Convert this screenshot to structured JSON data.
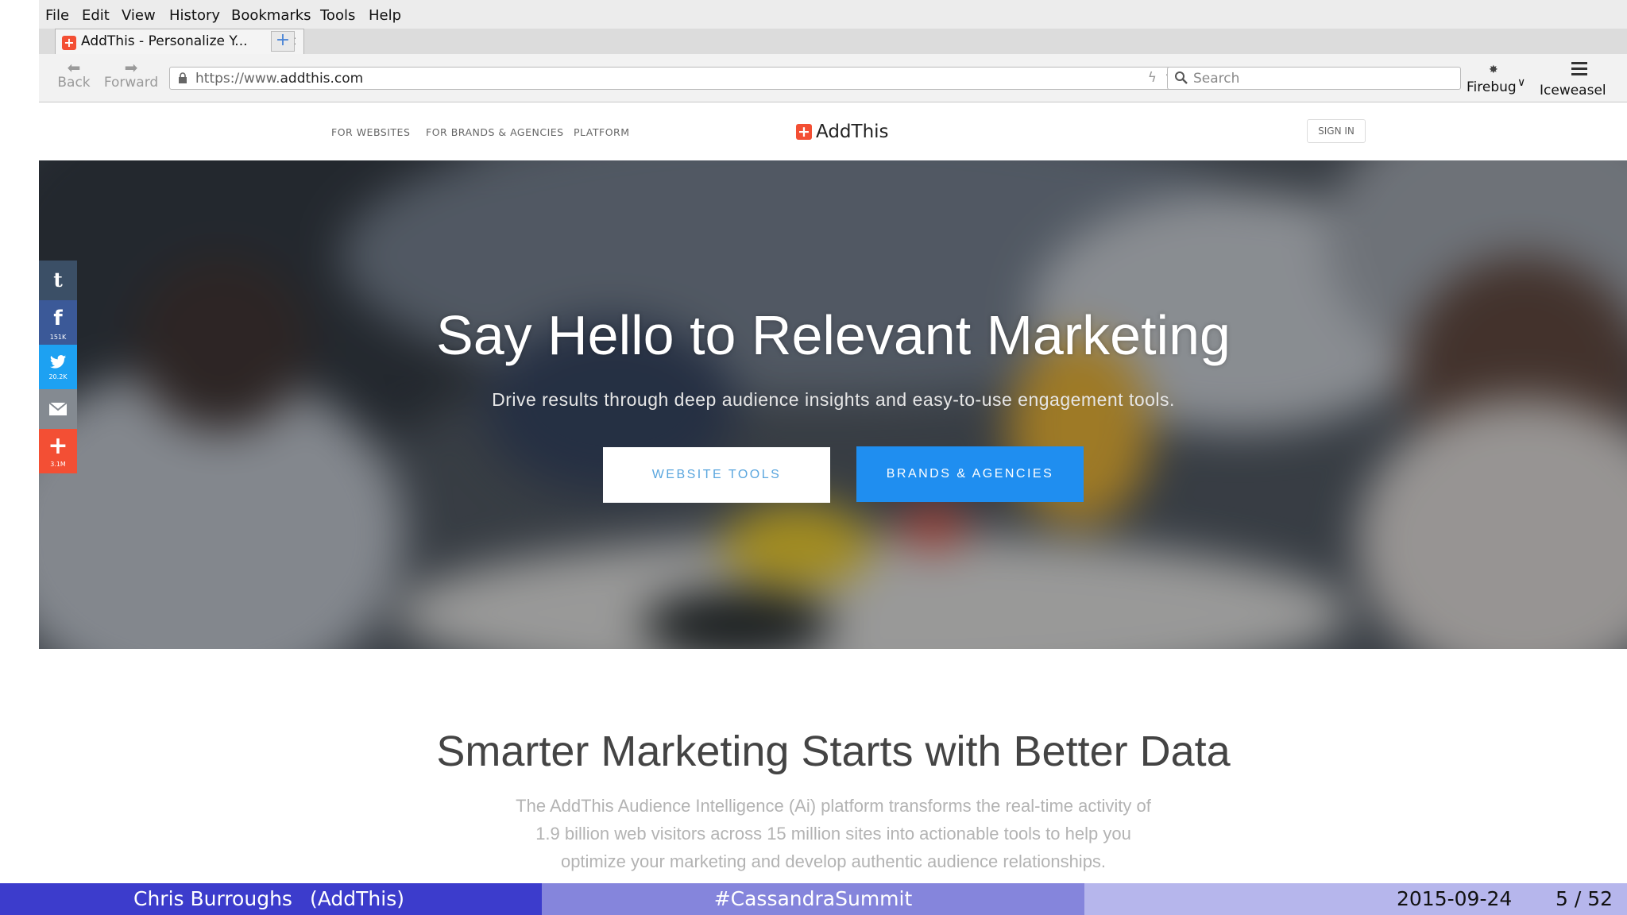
{
  "menubar": {
    "items": [
      "File",
      "Edit",
      "View",
      "History",
      "Bookmarks",
      "Tools",
      "Help"
    ]
  },
  "tab": {
    "title": "AddThis - Personalize Y...",
    "close": "×",
    "new_tab": "+"
  },
  "navbar": {
    "back_label": "Back",
    "forward_label": "Forward",
    "url_prefix": "https://www.",
    "url_domain": "addthis.com",
    "search_placeholder": "Search",
    "firebug_label": "Firebug",
    "menu_label": "Iceweasel"
  },
  "site": {
    "nav": [
      "FOR WEBSITES",
      "FOR BRANDS & AGENCIES",
      "PLATFORM"
    ],
    "logo_text": "AddThis",
    "signin_label": "SIGN IN"
  },
  "hero": {
    "title": "Say Hello to Relevant Marketing",
    "subtitle": "Drive results through deep audience insights and easy-to-use engagement tools.",
    "btn_website": "WEBSITE TOOLS",
    "btn_brands": "BRANDS & AGENCIES"
  },
  "share": {
    "facebook_count": "151K",
    "twitter_count": "20.2K",
    "more_count": "3.1M"
  },
  "lower": {
    "title": "Smarter Marketing Starts with Better Data",
    "body_line1": "The AddThis Audience Intelligence (Ai) platform transforms the real-time activity of",
    "body_line2": "1.9 billion web visitors across 15 million sites into actionable tools to help you",
    "body_line3": "optimize your marketing and develop authentic audience relationships."
  },
  "footer": {
    "author": "Chris Burroughs",
    "affiliation": "(AddThis)",
    "event": "#CassandraSummit",
    "date": "2015-09-24",
    "page": "5 / 52"
  },
  "colors": {
    "brand_red": "#f34f34",
    "brand_blue": "#1f8ef0",
    "footer_dark": "#3c3ccc",
    "footer_mid": "#8585dc",
    "footer_light": "#b6b6ec"
  }
}
